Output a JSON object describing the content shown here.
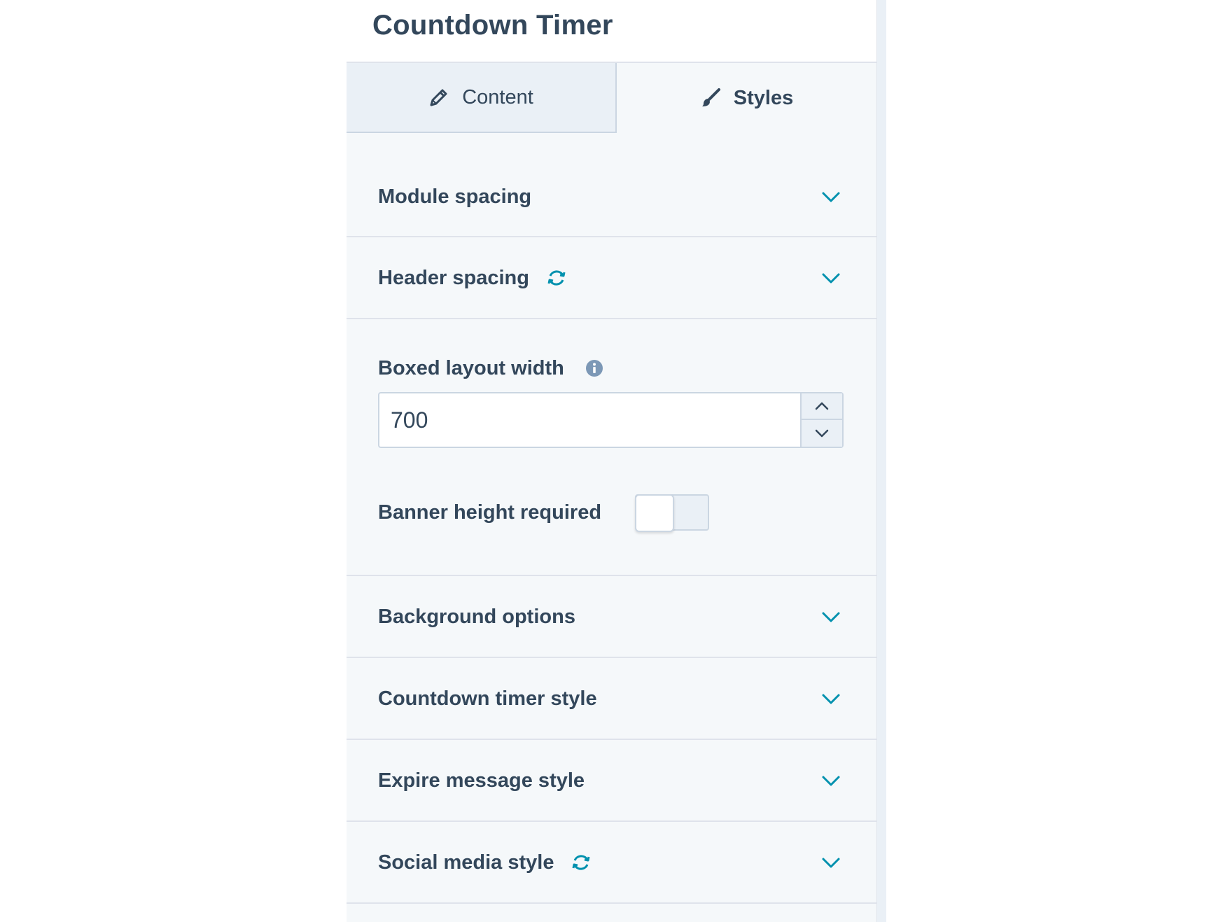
{
  "title": "Countdown Timer",
  "tabs": [
    {
      "label": "Content",
      "icon": "pencil-icon",
      "active": false
    },
    {
      "label": "Styles",
      "icon": "brush-icon",
      "active": true
    }
  ],
  "sections": {
    "module_spacing": {
      "label": "Module spacing"
    },
    "header_spacing": {
      "label": "Header spacing",
      "has_sync_icon": true
    },
    "background_options": {
      "label": "Background options"
    },
    "countdown_timer_style": {
      "label": "Countdown timer style"
    },
    "expire_message_style": {
      "label": "Expire message style"
    },
    "social_media_style": {
      "label": "Social media style",
      "has_sync_icon": true
    }
  },
  "boxed_layout": {
    "label": "Boxed layout width",
    "value": "700"
  },
  "banner_height": {
    "label": "Banner height required",
    "enabled": false
  },
  "colors": {
    "accent": "#0091ae",
    "text": "#33475b",
    "panel_bg": "#f5f8fa",
    "border": "#dfe3eb",
    "info_icon": "#7c98b6"
  }
}
